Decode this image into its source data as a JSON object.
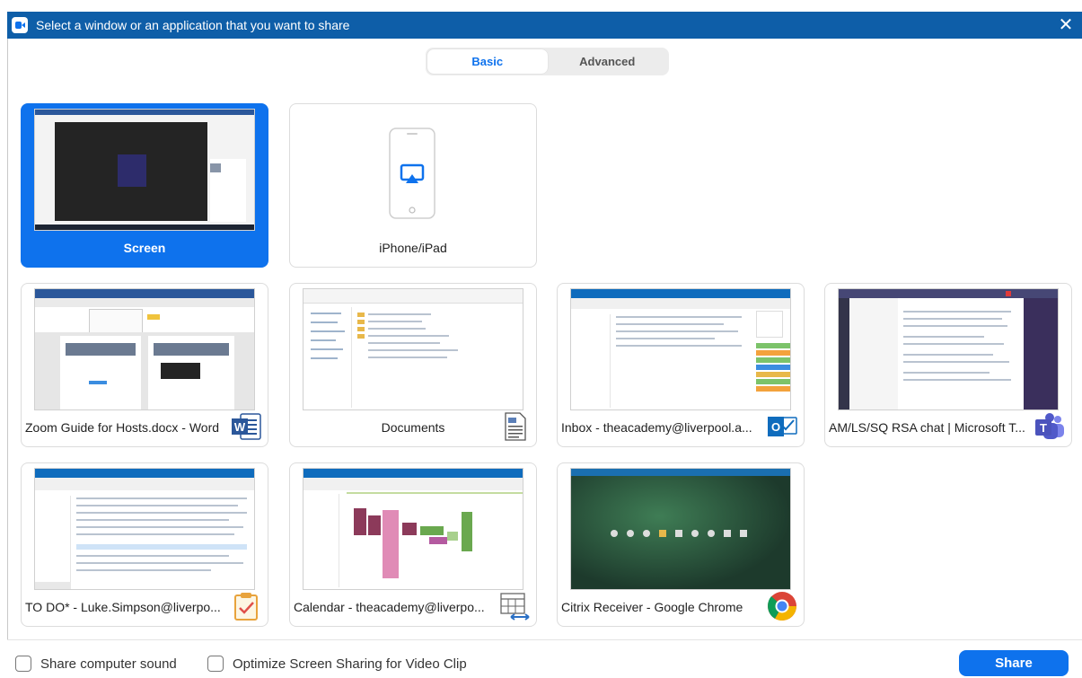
{
  "window": {
    "title": "Select a window or an application that you want to share",
    "close_glyph": "✕"
  },
  "tabs": [
    {
      "label": "Basic",
      "active": true
    },
    {
      "label": "Advanced",
      "active": false
    }
  ],
  "cards": [
    {
      "label": "Screen",
      "selected": true
    },
    {
      "label": "iPhone/iPad",
      "selected": false
    },
    {
      "label": "Zoom Guide for Hosts.docx - Word",
      "app_icon": "word-icon"
    },
    {
      "label": "Documents",
      "app_icon": "document-icon"
    },
    {
      "label": "Inbox - theacademy@liverpool.a...",
      "app_icon": "outlook-icon"
    },
    {
      "label": "AM/LS/SQ RSA chat | Microsoft T...",
      "app_icon": "teams-icon"
    },
    {
      "label": "TO DO* - Luke.Simpson@liverpo...",
      "app_icon": "tasks-icon"
    },
    {
      "label": "Calendar - theacademy@liverpo...",
      "app_icon": "calendar-icon"
    },
    {
      "label": "Citrix Receiver - Google Chrome",
      "app_icon": "chrome-icon"
    }
  ],
  "footer": {
    "share_sound": "Share computer sound",
    "optimize_video": "Optimize Screen Sharing for Video Clip",
    "share_button": "Share"
  },
  "colors": {
    "accent": "#0e72ed",
    "titlebar": "#0e5ea8"
  }
}
